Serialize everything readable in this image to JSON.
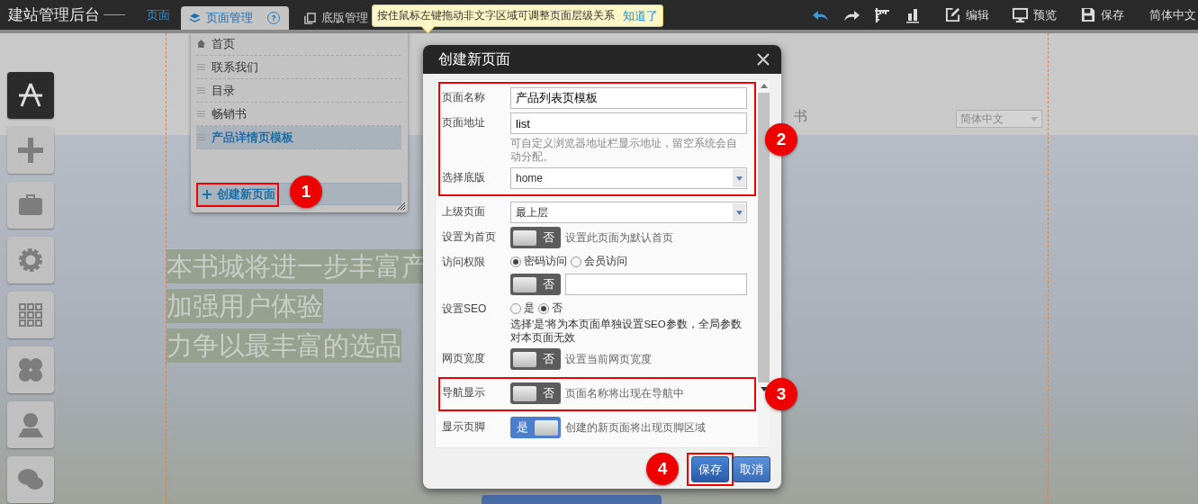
{
  "topbar": {
    "title": "建站管理后台",
    "nav_label": "页面",
    "tabs": [
      {
        "label": "页面管理",
        "selected": true,
        "help": "?"
      },
      {
        "label": "底版管理",
        "selected": false
      }
    ],
    "tooltip": {
      "text": "按住鼠标左键拖动非文字区域可调整页面层级关系",
      "link": "知道了"
    },
    "actions": [
      "编辑",
      "预览",
      "保存"
    ],
    "language": "简体中文"
  },
  "sidebar": {
    "items": [
      {
        "selected": true
      },
      {
        "selected": false
      },
      {
        "selected": false
      },
      {
        "selected": false
      },
      {
        "selected": false
      },
      {
        "selected": false
      },
      {
        "selected": false
      },
      {
        "selected": false
      }
    ]
  },
  "page_preview": {
    "nav_text": "书",
    "language_select": "简体中文",
    "hero_lines": [
      "本书城将进一步丰富产",
      "加强用户体验",
      "力争以最丰富的选品"
    ]
  },
  "pages_panel": {
    "items": [
      {
        "label": "首页",
        "kind": "home",
        "selected": false
      },
      {
        "label": "联系我们",
        "kind": "page",
        "selected": false
      },
      {
        "label": "目录",
        "kind": "page",
        "selected": false
      },
      {
        "label": "畅销书",
        "kind": "page",
        "selected": false
      },
      {
        "label": "产品详情页模板",
        "kind": "page",
        "selected": true
      }
    ],
    "create_button": {
      "label": "创建新页面",
      "callout": "1"
    }
  },
  "dialog": {
    "title": "创建新页面",
    "sections": [
      {
        "callout": "2",
        "fields": [
          {
            "kind": "text",
            "label": "页面名称",
            "value": "产品列表页模板"
          },
          {
            "kind": "text",
            "label": "页面地址",
            "value": "list",
            "hint": "可自定义浏览器地址栏显示地址，留空系统会自动分配。"
          },
          {
            "kind": "select",
            "label": "选择底版",
            "value": "home"
          }
        ]
      },
      {
        "fields": [
          {
            "kind": "select",
            "label": "上级页面",
            "value": "最上层"
          },
          {
            "kind": "toggle",
            "label": "设置为首页",
            "on": false,
            "state_text": "否",
            "hint": "设置此页面为默认首页"
          },
          {
            "kind": "radio",
            "label": "访问权限",
            "options": [
              {
                "label": "密码访问",
                "selected": true
              },
              {
                "label": "会员访问",
                "selected": false
              }
            ]
          },
          {
            "kind": "toggle_input",
            "on": false,
            "state_text": "否"
          },
          {
            "kind": "radio",
            "label": "设置SEO",
            "options": [
              {
                "label": "是",
                "selected": false
              },
              {
                "label": "否",
                "selected": true
              }
            ],
            "hint": "选择'是'将为本页面单独设置SEO参数，全局参数对本页面无效"
          },
          {
            "kind": "toggle",
            "label": "网页宽度",
            "on": false,
            "state_text": "否",
            "hint": "设置当前网页宽度"
          }
        ]
      },
      {
        "callout": "3",
        "fields": [
          {
            "kind": "toggle",
            "label": "导航显示",
            "on": false,
            "state_text": "否",
            "hint": "页面名称将出现在导航中"
          }
        ]
      },
      {
        "fields": [
          {
            "kind": "toggle",
            "label": "显示页脚",
            "on": true,
            "state_text": "是",
            "hint": "创建的新页面将出现页脚区域"
          }
        ]
      }
    ],
    "buttons": [
      {
        "label": "保存",
        "kind": "primary",
        "callout": "4"
      },
      {
        "label": "取消",
        "kind": "secondary"
      }
    ]
  }
}
